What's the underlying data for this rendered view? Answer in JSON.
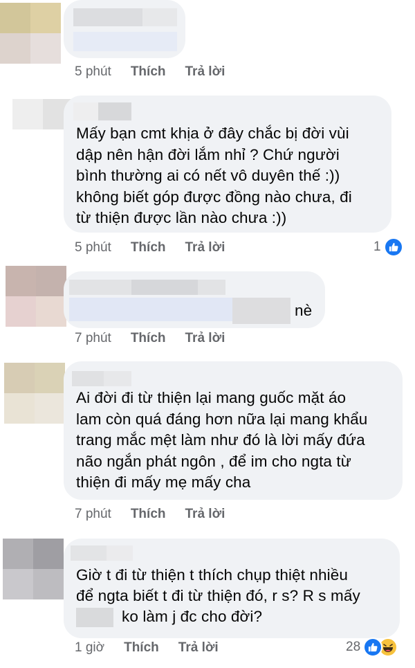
{
  "colors": {
    "bubble": "#f0f2f5",
    "meta_text": "#65676b",
    "like_blue": "#1877f2",
    "haha_yellow": "#f7c23d"
  },
  "comments": [
    {
      "text": "",
      "time": "5 phút",
      "like_label": "Thích",
      "reply_label": "Trả lời",
      "reaction_count": ""
    },
    {
      "text": "Mấy bạn cmt khịa ở đây chắc bị đời vùi\ndập nên hận đời lắm nhỉ ? Chứ người\nbình thường ai có nết vô duyên thế :))\nkhông biết góp được đồng nào chưa, đi\ntừ thiện được lần nào chưa :))",
      "time": "5 phút",
      "like_label": "Thích",
      "reply_label": "Trả lời",
      "reaction_count": "1",
      "reactions": [
        "like-icon"
      ]
    },
    {
      "text": "nè",
      "time": "7 phút",
      "like_label": "Thích",
      "reply_label": "Trả lời",
      "reaction_count": ""
    },
    {
      "text": "Ai đời đi từ thiện lại mang guốc mặt áo\nlam còn quá đáng hơn nữa lại mang khẩu\ntrang mắc mệt làm như đó là lời mấy đứa\nnão ngắn phát ngôn , để im cho ngta từ\nthiện đi mấy mẹ mấy cha",
      "time": "7 phút",
      "like_label": "Thích",
      "reply_label": "Trả lời",
      "reaction_count": ""
    },
    {
      "text_line1": "Giờ t đi từ thiện t thích chụp thiệt nhiều",
      "text_line2": "để ngta biết t đi từ thiện đó, r s? R s mấy",
      "text_line3": "ko làm j đc cho đời?",
      "time": "1 giờ",
      "like_label": "Thích",
      "reply_label": "Trả lời",
      "reaction_count": "28",
      "reactions": [
        "like-icon",
        "haha-icon"
      ]
    }
  ]
}
